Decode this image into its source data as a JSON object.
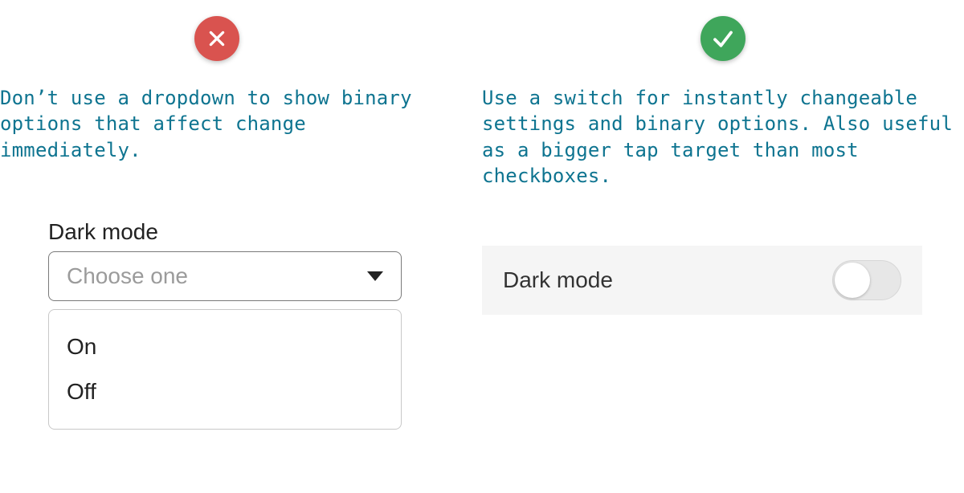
{
  "left": {
    "caption": "Don’t use a dropdown to show binary options that affect change immediately.",
    "label": "Dark mode",
    "placeholder": "Choose one",
    "options": [
      "On",
      "Off"
    ]
  },
  "right": {
    "caption": "Use a switch for instantly changeable settings and binary options. Also useful as a bigger tap target than most checkboxes.",
    "label": "Dark mode",
    "switch_on": false
  }
}
